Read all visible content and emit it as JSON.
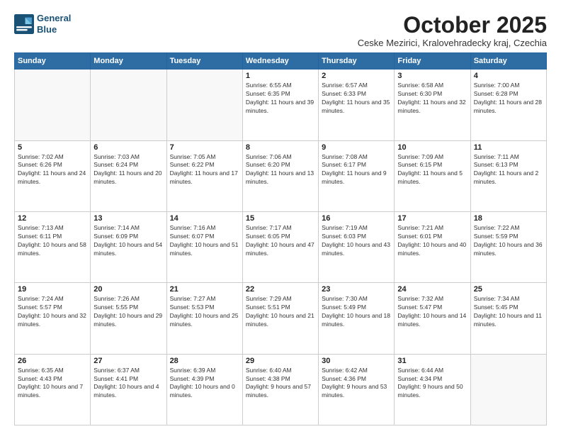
{
  "logo": {
    "line1": "General",
    "line2": "Blue"
  },
  "title": {
    "month_year": "October 2025",
    "location": "Ceske Mezirici, Kralovehradecky kraj, Czechia"
  },
  "weekdays": [
    "Sunday",
    "Monday",
    "Tuesday",
    "Wednesday",
    "Thursday",
    "Friday",
    "Saturday"
  ],
  "weeks": [
    [
      {
        "day": "",
        "sunrise": "",
        "sunset": "",
        "daylight": ""
      },
      {
        "day": "",
        "sunrise": "",
        "sunset": "",
        "daylight": ""
      },
      {
        "day": "",
        "sunrise": "",
        "sunset": "",
        "daylight": ""
      },
      {
        "day": "1",
        "sunrise": "Sunrise: 6:55 AM",
        "sunset": "Sunset: 6:35 PM",
        "daylight": "Daylight: 11 hours and 39 minutes."
      },
      {
        "day": "2",
        "sunrise": "Sunrise: 6:57 AM",
        "sunset": "Sunset: 6:33 PM",
        "daylight": "Daylight: 11 hours and 35 minutes."
      },
      {
        "day": "3",
        "sunrise": "Sunrise: 6:58 AM",
        "sunset": "Sunset: 6:30 PM",
        "daylight": "Daylight: 11 hours and 32 minutes."
      },
      {
        "day": "4",
        "sunrise": "Sunrise: 7:00 AM",
        "sunset": "Sunset: 6:28 PM",
        "daylight": "Daylight: 11 hours and 28 minutes."
      }
    ],
    [
      {
        "day": "5",
        "sunrise": "Sunrise: 7:02 AM",
        "sunset": "Sunset: 6:26 PM",
        "daylight": "Daylight: 11 hours and 24 minutes."
      },
      {
        "day": "6",
        "sunrise": "Sunrise: 7:03 AM",
        "sunset": "Sunset: 6:24 PM",
        "daylight": "Daylight: 11 hours and 20 minutes."
      },
      {
        "day": "7",
        "sunrise": "Sunrise: 7:05 AM",
        "sunset": "Sunset: 6:22 PM",
        "daylight": "Daylight: 11 hours and 17 minutes."
      },
      {
        "day": "8",
        "sunrise": "Sunrise: 7:06 AM",
        "sunset": "Sunset: 6:20 PM",
        "daylight": "Daylight: 11 hours and 13 minutes."
      },
      {
        "day": "9",
        "sunrise": "Sunrise: 7:08 AM",
        "sunset": "Sunset: 6:17 PM",
        "daylight": "Daylight: 11 hours and 9 minutes."
      },
      {
        "day": "10",
        "sunrise": "Sunrise: 7:09 AM",
        "sunset": "Sunset: 6:15 PM",
        "daylight": "Daylight: 11 hours and 5 minutes."
      },
      {
        "day": "11",
        "sunrise": "Sunrise: 7:11 AM",
        "sunset": "Sunset: 6:13 PM",
        "daylight": "Daylight: 11 hours and 2 minutes."
      }
    ],
    [
      {
        "day": "12",
        "sunrise": "Sunrise: 7:13 AM",
        "sunset": "Sunset: 6:11 PM",
        "daylight": "Daylight: 10 hours and 58 minutes."
      },
      {
        "day": "13",
        "sunrise": "Sunrise: 7:14 AM",
        "sunset": "Sunset: 6:09 PM",
        "daylight": "Daylight: 10 hours and 54 minutes."
      },
      {
        "day": "14",
        "sunrise": "Sunrise: 7:16 AM",
        "sunset": "Sunset: 6:07 PM",
        "daylight": "Daylight: 10 hours and 51 minutes."
      },
      {
        "day": "15",
        "sunrise": "Sunrise: 7:17 AM",
        "sunset": "Sunset: 6:05 PM",
        "daylight": "Daylight: 10 hours and 47 minutes."
      },
      {
        "day": "16",
        "sunrise": "Sunrise: 7:19 AM",
        "sunset": "Sunset: 6:03 PM",
        "daylight": "Daylight: 10 hours and 43 minutes."
      },
      {
        "day": "17",
        "sunrise": "Sunrise: 7:21 AM",
        "sunset": "Sunset: 6:01 PM",
        "daylight": "Daylight: 10 hours and 40 minutes."
      },
      {
        "day": "18",
        "sunrise": "Sunrise: 7:22 AM",
        "sunset": "Sunset: 5:59 PM",
        "daylight": "Daylight: 10 hours and 36 minutes."
      }
    ],
    [
      {
        "day": "19",
        "sunrise": "Sunrise: 7:24 AM",
        "sunset": "Sunset: 5:57 PM",
        "daylight": "Daylight: 10 hours and 32 minutes."
      },
      {
        "day": "20",
        "sunrise": "Sunrise: 7:26 AM",
        "sunset": "Sunset: 5:55 PM",
        "daylight": "Daylight: 10 hours and 29 minutes."
      },
      {
        "day": "21",
        "sunrise": "Sunrise: 7:27 AM",
        "sunset": "Sunset: 5:53 PM",
        "daylight": "Daylight: 10 hours and 25 minutes."
      },
      {
        "day": "22",
        "sunrise": "Sunrise: 7:29 AM",
        "sunset": "Sunset: 5:51 PM",
        "daylight": "Daylight: 10 hours and 21 minutes."
      },
      {
        "day": "23",
        "sunrise": "Sunrise: 7:30 AM",
        "sunset": "Sunset: 5:49 PM",
        "daylight": "Daylight: 10 hours and 18 minutes."
      },
      {
        "day": "24",
        "sunrise": "Sunrise: 7:32 AM",
        "sunset": "Sunset: 5:47 PM",
        "daylight": "Daylight: 10 hours and 14 minutes."
      },
      {
        "day": "25",
        "sunrise": "Sunrise: 7:34 AM",
        "sunset": "Sunset: 5:45 PM",
        "daylight": "Daylight: 10 hours and 11 minutes."
      }
    ],
    [
      {
        "day": "26",
        "sunrise": "Sunrise: 6:35 AM",
        "sunset": "Sunset: 4:43 PM",
        "daylight": "Daylight: 10 hours and 7 minutes."
      },
      {
        "day": "27",
        "sunrise": "Sunrise: 6:37 AM",
        "sunset": "Sunset: 4:41 PM",
        "daylight": "Daylight: 10 hours and 4 minutes."
      },
      {
        "day": "28",
        "sunrise": "Sunrise: 6:39 AM",
        "sunset": "Sunset: 4:39 PM",
        "daylight": "Daylight: 10 hours and 0 minutes."
      },
      {
        "day": "29",
        "sunrise": "Sunrise: 6:40 AM",
        "sunset": "Sunset: 4:38 PM",
        "daylight": "Daylight: 9 hours and 57 minutes."
      },
      {
        "day": "30",
        "sunrise": "Sunrise: 6:42 AM",
        "sunset": "Sunset: 4:36 PM",
        "daylight": "Daylight: 9 hours and 53 minutes."
      },
      {
        "day": "31",
        "sunrise": "Sunrise: 6:44 AM",
        "sunset": "Sunset: 4:34 PM",
        "daylight": "Daylight: 9 hours and 50 minutes."
      },
      {
        "day": "",
        "sunrise": "",
        "sunset": "",
        "daylight": ""
      }
    ]
  ]
}
